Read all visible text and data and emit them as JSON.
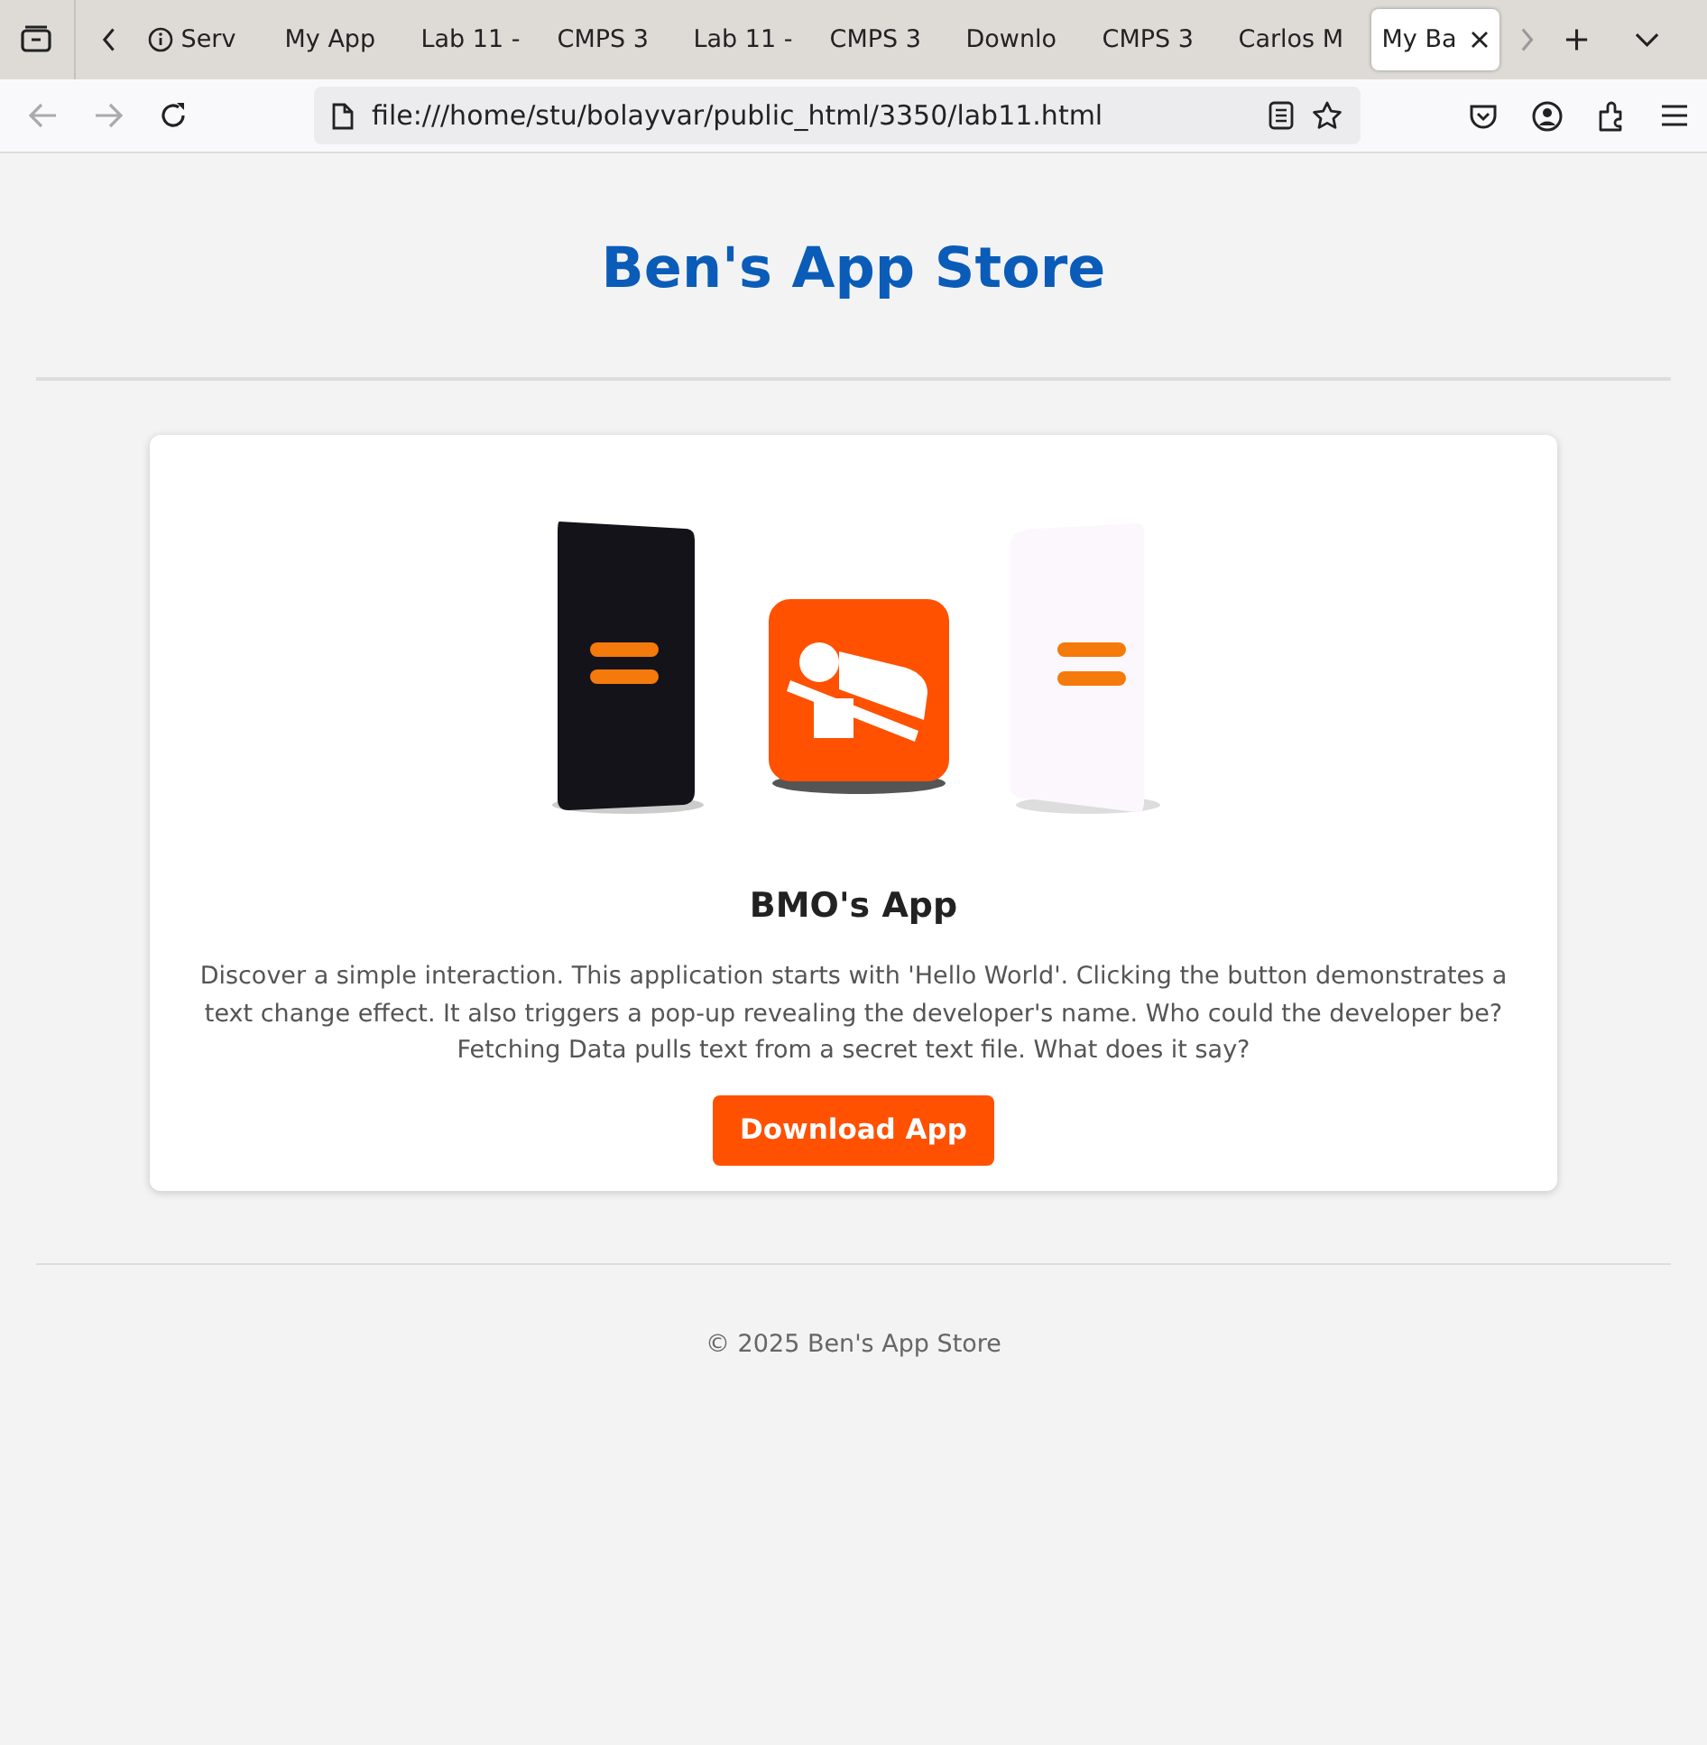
{
  "browser": {
    "tabs": [
      {
        "label": "Serv",
        "kind": "info",
        "selected": false
      },
      {
        "label": "My App",
        "kind": "plain",
        "selected": false
      },
      {
        "label": "Lab 11 -",
        "kind": "plain",
        "selected": false
      },
      {
        "label": "CMPS 3",
        "kind": "plain",
        "selected": false
      },
      {
        "label": "Lab 11 -",
        "kind": "plain",
        "selected": false
      },
      {
        "label": "CMPS 3",
        "kind": "plain",
        "selected": false
      },
      {
        "label": "Downlo",
        "kind": "plain",
        "selected": false
      },
      {
        "label": "CMPS 3",
        "kind": "plain",
        "selected": false
      },
      {
        "label": "Carlos M",
        "kind": "plain",
        "selected": false
      },
      {
        "label": "My Ba",
        "kind": "plain",
        "selected": true
      }
    ],
    "url": "file:///home/stu/bolayvar/public_html/3350/lab11.html"
  },
  "page": {
    "title": "Ben's App Store",
    "app": {
      "name": "BMO's App",
      "description": "Discover a simple interaction. This application starts with 'Hello World'. Clicking the button demonstrates a text change effect. It also triggers a pop-up revealing the developer's name. Who could the developer be? Fetching Data pulls text from a secret text file. What does it say?",
      "button": "Download App"
    },
    "footer": "© 2025 Ben's App Store"
  }
}
